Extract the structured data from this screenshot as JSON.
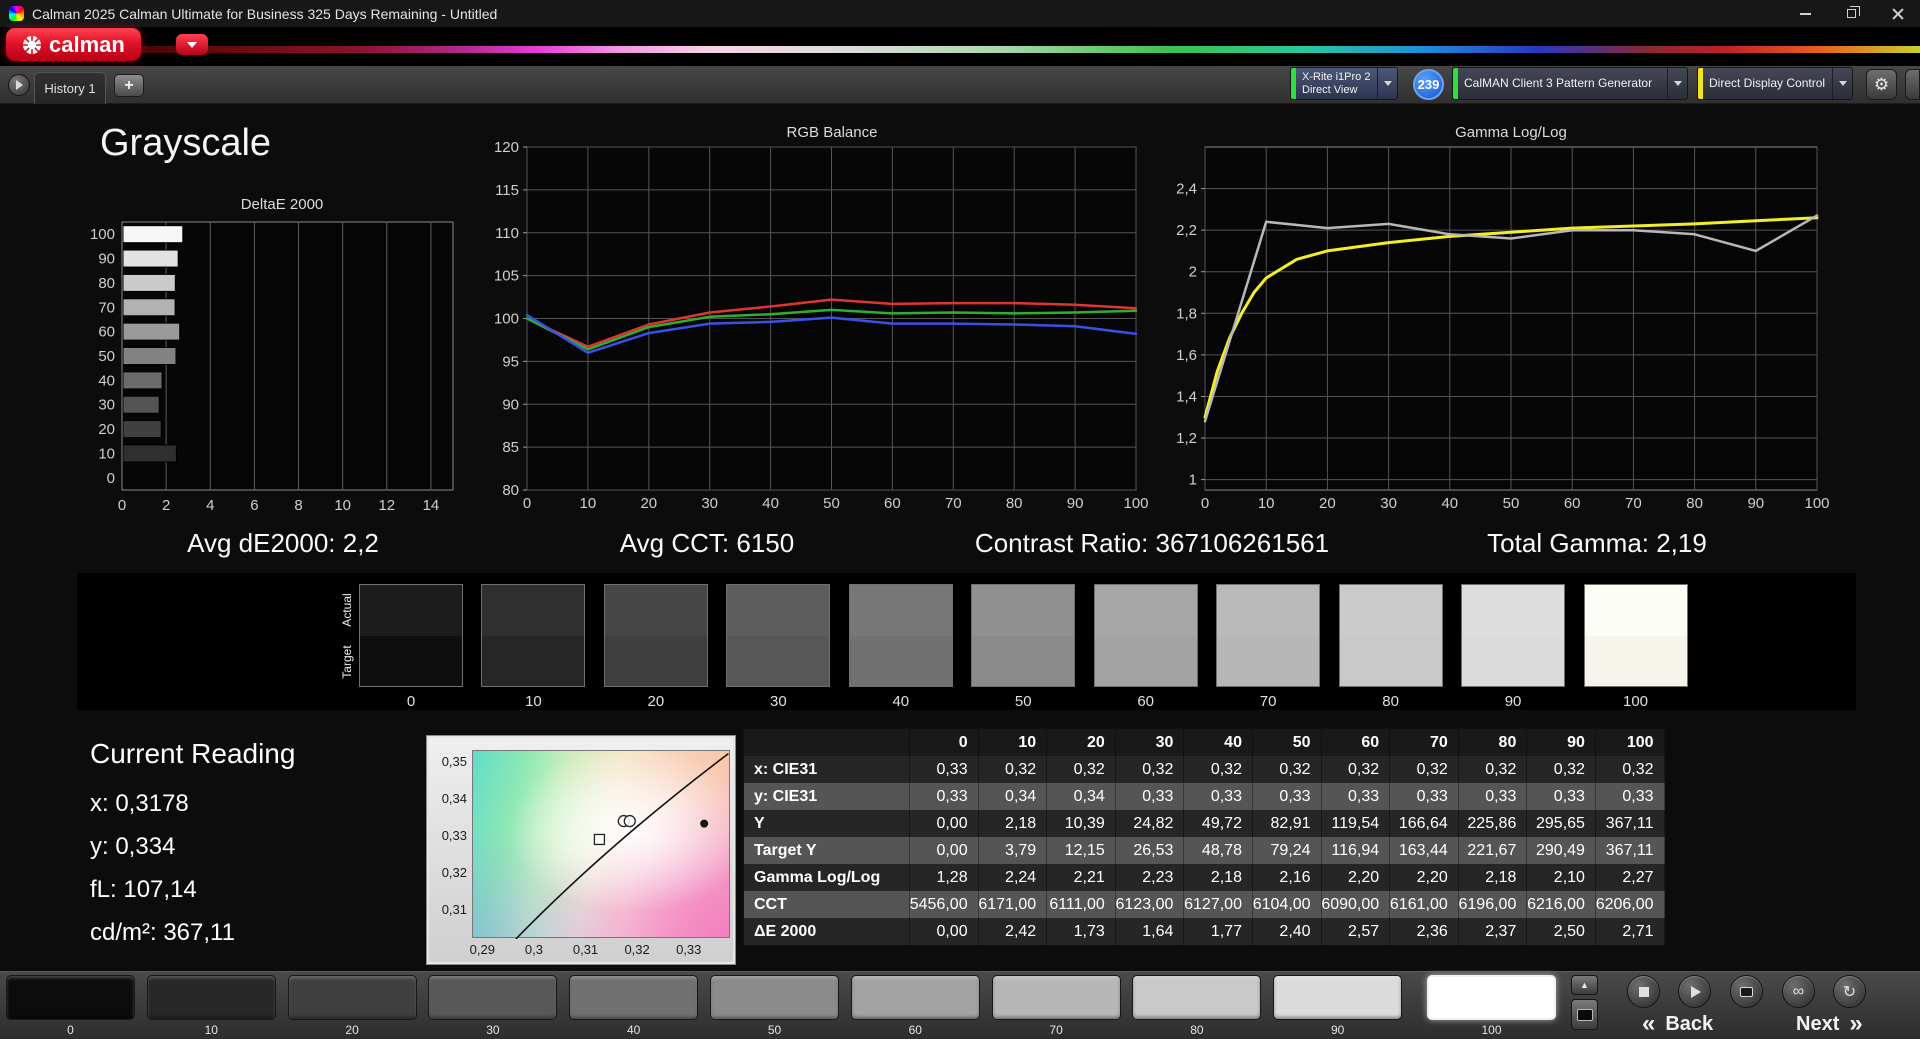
{
  "window": {
    "title": "Calman 2025 Calman Ultimate for Business 325 Days Remaining  - Untitled"
  },
  "brand": {
    "logo_text": "calman"
  },
  "tab_bar": {
    "tabs": [
      {
        "label": "History 1"
      }
    ],
    "add_label": "+",
    "meter": {
      "line1": "X-Rite i1Pro 2",
      "line2": "Direct View"
    },
    "device_badge": "239",
    "pattern_label": "CalMAN Client 3 Pattern Generator",
    "display_label": "Direct Display Control"
  },
  "page": {
    "title": "Grayscale"
  },
  "stats": [
    {
      "text": "Avg dE2000: 2,2"
    },
    {
      "text": "Avg CCT: 6150"
    },
    {
      "text": "Contrast Ratio: 367106261561"
    },
    {
      "text": "Total Gamma: 2,19"
    }
  ],
  "swatch_panel": {
    "actual_label": "Actual",
    "target_label": "Target",
    "levels": [
      {
        "label": "0",
        "actual": "#1c1c1c",
        "target": "#0e0e0e"
      },
      {
        "label": "10",
        "actual": "#2f2f2f",
        "target": "#272727"
      },
      {
        "label": "20",
        "actual": "#464646",
        "target": "#3f3f3f"
      },
      {
        "label": "30",
        "actual": "#5d5d5d",
        "target": "#575757"
      },
      {
        "label": "40",
        "actual": "#777777",
        "target": "#717171"
      },
      {
        "label": "50",
        "actual": "#909090",
        "target": "#8b8b8b"
      },
      {
        "label": "60",
        "actual": "#a7a7a7",
        "target": "#a3a3a3"
      },
      {
        "label": "70",
        "actual": "#bababa",
        "target": "#b7b7b7"
      },
      {
        "label": "80",
        "actual": "#cbcbcb",
        "target": "#c9c9c9"
      },
      {
        "label": "90",
        "actual": "#dddddd",
        "target": "#dbdbdb"
      },
      {
        "label": "100",
        "actual": "#fdfdf8",
        "target": "#f7f4ec"
      }
    ]
  },
  "current_reading": {
    "title": "Current Reading",
    "lines": [
      "x: 0,3178",
      "y: 0,334",
      "fL: 107,14",
      "cd/m²: 367,11"
    ]
  },
  "table": {
    "columns": [
      "0",
      "10",
      "20",
      "30",
      "40",
      "50",
      "60",
      "70",
      "80",
      "90",
      "100"
    ],
    "rows": [
      {
        "label": "x: CIE31",
        "values": [
          "0,33",
          "0,32",
          "0,32",
          "0,32",
          "0,32",
          "0,32",
          "0,32",
          "0,32",
          "0,32",
          "0,32",
          "0,32"
        ]
      },
      {
        "label": "y: CIE31",
        "values": [
          "0,33",
          "0,34",
          "0,34",
          "0,33",
          "0,33",
          "0,33",
          "0,33",
          "0,33",
          "0,33",
          "0,33",
          "0,33"
        ]
      },
      {
        "label": "Y",
        "values": [
          "0,00",
          "2,18",
          "10,39",
          "24,82",
          "49,72",
          "82,91",
          "119,54",
          "166,64",
          "225,86",
          "295,65",
          "367,11"
        ]
      },
      {
        "label": "Target Y",
        "values": [
          "0,00",
          "3,79",
          "12,15",
          "26,53",
          "48,78",
          "79,24",
          "116,94",
          "163,44",
          "221,67",
          "290,49",
          "367,11"
        ]
      },
      {
        "label": "Gamma Log/Log",
        "values": [
          "1,28",
          "2,24",
          "2,21",
          "2,23",
          "2,18",
          "2,16",
          "2,20",
          "2,20",
          "2,18",
          "2,10",
          "2,27"
        ]
      },
      {
        "label": "CCT",
        "values": [
          "5456,00",
          "6171,00",
          "6111,00",
          "6123,00",
          "6127,00",
          "6104,00",
          "6090,00",
          "6161,00",
          "6196,00",
          "6216,00",
          "6206,00"
        ]
      },
      {
        "label": "ΔE 2000",
        "values": [
          "0,00",
          "2,42",
          "1,73",
          "1,64",
          "1,77",
          "2,40",
          "2,57",
          "2,36",
          "2,37",
          "2,50",
          "2,71"
        ]
      }
    ]
  },
  "patch_bar": {
    "patches": [
      {
        "label": "0",
        "color": "#0c0c0c"
      },
      {
        "label": "10",
        "color": "#272727"
      },
      {
        "label": "20",
        "color": "#3f3f3f"
      },
      {
        "label": "30",
        "color": "#585858"
      },
      {
        "label": "40",
        "color": "#717171"
      },
      {
        "label": "50",
        "color": "#8b8b8b"
      },
      {
        "label": "60",
        "color": "#a3a3a3"
      },
      {
        "label": "70",
        "color": "#b7b7b7"
      },
      {
        "label": "80",
        "color": "#c9c9c9"
      },
      {
        "label": "90",
        "color": "#dbdbdb"
      },
      {
        "label": "100",
        "color": "#ffffff",
        "selected": true
      }
    ]
  },
  "transport": {
    "back_glyph": "«",
    "back_label": "Back",
    "next_label": "Next",
    "next_glyph": "»"
  },
  "icons": {
    "gear": "⚙",
    "infinity": "∞",
    "loop": "↻",
    "collapse": "▲"
  },
  "chart_data": [
    {
      "id": "deltae2000",
      "type": "bar",
      "orientation": "horizontal",
      "title": "DeltaE 2000",
      "categories": [
        "100",
        "90",
        "80",
        "70",
        "60",
        "50",
        "40",
        "30",
        "20",
        "10",
        "0"
      ],
      "values": [
        2.71,
        2.5,
        2.37,
        2.36,
        2.57,
        2.4,
        1.77,
        1.64,
        1.73,
        2.42,
        0.0
      ],
      "bar_colors": [
        "#f7f7f7",
        "#e2e2e2",
        "#cacaca",
        "#b2b2b2",
        "#9a9a9a",
        "#828282",
        "#6b6b6b",
        "#545454",
        "#404040",
        "#2f2f2f",
        "#000000"
      ],
      "xlim": [
        0,
        15
      ],
      "xticks": [
        0,
        2,
        4,
        6,
        8,
        10,
        12,
        14
      ],
      "xlabel": "",
      "ylabel": ""
    },
    {
      "id": "rgb_balance",
      "type": "line",
      "title": "RGB Balance",
      "x": [
        0,
        10,
        20,
        30,
        40,
        50,
        60,
        70,
        80,
        90,
        100
      ],
      "series": [
        {
          "name": "Red",
          "color": "#e03434",
          "values": [
            100,
            96.7,
            99.3,
            100.7,
            101.4,
            102.2,
            101.7,
            101.8,
            101.8,
            101.6,
            101.2
          ]
        },
        {
          "name": "Green",
          "color": "#2fae2f",
          "values": [
            100,
            96.4,
            99.0,
            100.2,
            100.5,
            101.0,
            100.6,
            100.7,
            100.6,
            100.7,
            100.9
          ]
        },
        {
          "name": "Blue",
          "color": "#3a50e8",
          "values": [
            100.4,
            96.0,
            98.3,
            99.4,
            99.6,
            100.1,
            99.4,
            99.4,
            99.3,
            99.1,
            98.2
          ]
        }
      ],
      "ylim": [
        80,
        120
      ],
      "yticks": [
        "120",
        "115",
        "110",
        "105",
        "100",
        "95",
        "90",
        "85",
        "80"
      ],
      "ytick_values": [
        120,
        115,
        110,
        105,
        100,
        95,
        90,
        85,
        80
      ],
      "xticks": [
        0,
        10,
        20,
        30,
        40,
        50,
        60,
        70,
        80,
        90,
        100
      ],
      "legend": "none"
    },
    {
      "id": "gamma_loglog",
      "type": "line",
      "title": "Gamma Log/Log",
      "series": [
        {
          "name": "Target",
          "color": "#f2ee2a",
          "width": 3,
          "x": [
            0,
            2,
            4,
            6,
            8,
            10,
            15,
            20,
            30,
            40,
            50,
            60,
            70,
            80,
            90,
            100
          ],
          "values": [
            1.3,
            1.52,
            1.68,
            1.8,
            1.9,
            1.97,
            2.06,
            2.1,
            2.14,
            2.17,
            2.19,
            2.21,
            2.22,
            2.23,
            2.245,
            2.26
          ]
        },
        {
          "name": "Measured",
          "color": "#b8b8b8",
          "width": 2.5,
          "x": [
            0,
            10,
            20,
            30,
            40,
            50,
            60,
            70,
            80,
            90,
            100
          ],
          "values": [
            1.28,
            2.24,
            2.21,
            2.23,
            2.18,
            2.16,
            2.2,
            2.2,
            2.18,
            2.1,
            2.27
          ]
        }
      ],
      "ylim": [
        0.95,
        2.6
      ],
      "yticks": [
        "2,4",
        "2,2",
        "2",
        "1,8",
        "1,6",
        "1,4",
        "1,2",
        "1"
      ],
      "ytick_values": [
        2.4,
        2.2,
        2.0,
        1.8,
        1.6,
        1.4,
        1.2,
        1.0
      ],
      "xticks": [
        0,
        10,
        20,
        30,
        40,
        50,
        60,
        70,
        80,
        90,
        100
      ],
      "legend": "none"
    },
    {
      "id": "cie_chromaticity",
      "type": "scatter",
      "title": "",
      "xlim": [
        0.288,
        0.338
      ],
      "ylim": [
        0.302,
        0.353
      ],
      "xticks": [
        {
          "v": 0.29,
          "label": "0,29"
        },
        {
          "v": 0.3,
          "label": "0,3"
        },
        {
          "v": 0.31,
          "label": "0,31"
        },
        {
          "v": 0.32,
          "label": "0,32"
        },
        {
          "v": 0.33,
          "label": "0,33"
        }
      ],
      "yticks": [
        {
          "v": 0.35,
          "label": "0,35"
        },
        {
          "v": 0.34,
          "label": "0,34"
        },
        {
          "v": 0.33,
          "label": "0,33"
        },
        {
          "v": 0.32,
          "label": "0,32"
        },
        {
          "v": 0.31,
          "label": "0,31"
        }
      ],
      "locus": {
        "start": [
          0.2963,
          0.302
        ],
        "control": [
          0.314,
          0.3274
        ],
        "end": [
          0.3375,
          0.3523
        ]
      },
      "points": [
        {
          "x": 0.3178,
          "y": 0.334,
          "marker": "reading-circles"
        },
        {
          "x": 0.3125,
          "y": 0.329,
          "marker": "target-square"
        },
        {
          "x": 0.3328,
          "y": 0.3333,
          "marker": "reference-dot"
        }
      ]
    }
  ]
}
